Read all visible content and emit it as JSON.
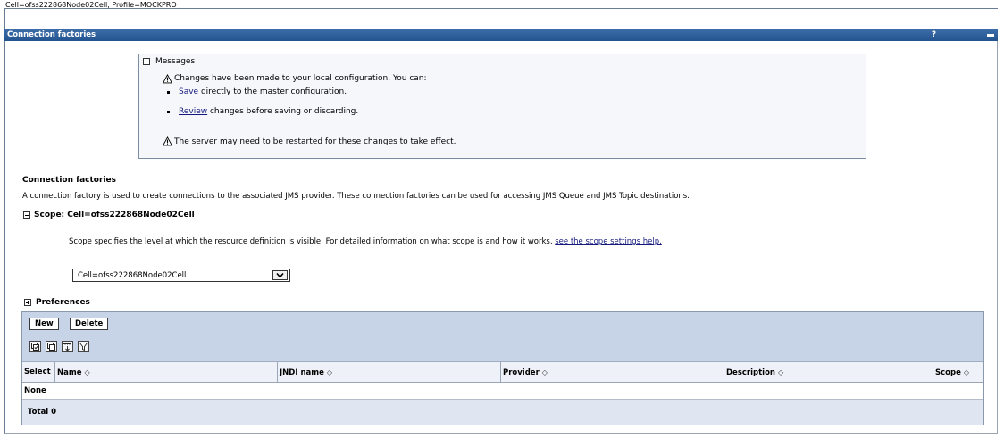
{
  "breadcrumb": "Cell=ofss222868Node02Cell, Profile=MOCKPRO",
  "panel": {
    "title": "Connection factories",
    "help_label": "?"
  },
  "messages": {
    "header": "Messages",
    "line1": "Changes have been made to your local configuration. You can:",
    "save_link": "Save ",
    "save_rest": "directly to the master configuration.",
    "review_link": "Review",
    "review_rest": " changes before saving or discarding.",
    "line_restart": "The server may need to be restarted for these changes to take effect.",
    "icon": "warning-triangle-icon"
  },
  "section": {
    "title": "Connection factories",
    "description": "A connection factory is used to create connections to the associated JMS provider. These connection factories can be used for accessing JMS Queue and JMS Topic destinations."
  },
  "scope": {
    "header": "Scope: Cell=",
    "header_value": "ofss222868Node02Cell",
    "text": "Scope specifies the level at which the resource definition is visible. For detailed information on what scope is and how it works, ",
    "link": "see the scope settings help.",
    "selected": "Cell=ofss222868Node02Cell"
  },
  "preferences": {
    "label": "Preferences"
  },
  "table": {
    "buttons": {
      "new": "New",
      "delete": "Delete"
    },
    "icons": [
      "select-all-icon",
      "deselect-all-icon",
      "expand-filter-icon",
      "show-filter-icon"
    ],
    "columns": [
      "Select",
      "Name",
      "JNDI name",
      "Provider",
      "Description",
      "Scope"
    ],
    "sort_glyph": "◇",
    "empty_text": "None",
    "total_label": "Total 0"
  },
  "colors": {
    "titlebar": "#2f5f9b",
    "toolbar": "#c7d3e6",
    "link": "#15197e"
  }
}
